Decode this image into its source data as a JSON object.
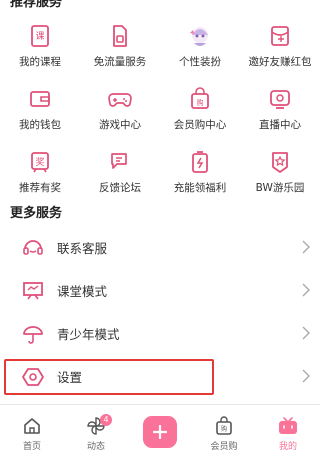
{
  "top_section_partial": "推荐服务",
  "grid": [
    [
      {
        "label": "我的课程",
        "icon": "course-book-icon"
      },
      {
        "label": "免流量服务",
        "icon": "sim-card-icon"
      },
      {
        "label": "个性装扮",
        "icon": "anime-avatar-icon"
      },
      {
        "label": "邀好友赚红包",
        "icon": "red-envelope-icon"
      }
    ],
    [
      {
        "label": "我的钱包",
        "icon": "wallet-icon"
      },
      {
        "label": "游戏中心",
        "icon": "gamepad-icon"
      },
      {
        "label": "会员购中心",
        "icon": "shopping-bag-icon"
      },
      {
        "label": "直播中心",
        "icon": "tv-icon"
      }
    ],
    [
      {
        "label": "推荐有奖",
        "icon": "reward-ticket-icon"
      },
      {
        "label": "反馈论坛",
        "icon": "chat-bubbles-icon"
      },
      {
        "label": "充能领福利",
        "icon": "battery-charge-icon"
      },
      {
        "label": "BW游乐园",
        "icon": "star-badge-icon"
      }
    ]
  ],
  "more_services": {
    "title": "更多服务",
    "items": [
      {
        "label": "联系客服",
        "icon": "headset-icon"
      },
      {
        "label": "课堂模式",
        "icon": "classroom-easel-icon"
      },
      {
        "label": "青少年模式",
        "icon": "umbrella-icon"
      },
      {
        "label": "设置",
        "icon": "settings-hexagon-icon"
      }
    ]
  },
  "tabbar": {
    "tabs": [
      {
        "label": "首页",
        "icon": "home-icon"
      },
      {
        "label": "动态",
        "icon": "pinwheel-icon",
        "badge": "4"
      },
      {
        "label": "",
        "icon": "plus-icon"
      },
      {
        "label": "会员购",
        "icon": "shopping-bag-icon"
      },
      {
        "label": "我的",
        "icon": "tv-face-icon"
      }
    ],
    "active_tab": "我的"
  },
  "colors": {
    "accent": "#fb7299",
    "icon_stroke": "#e0517a",
    "highlight_border": "#e53935",
    "text": "#333333"
  }
}
